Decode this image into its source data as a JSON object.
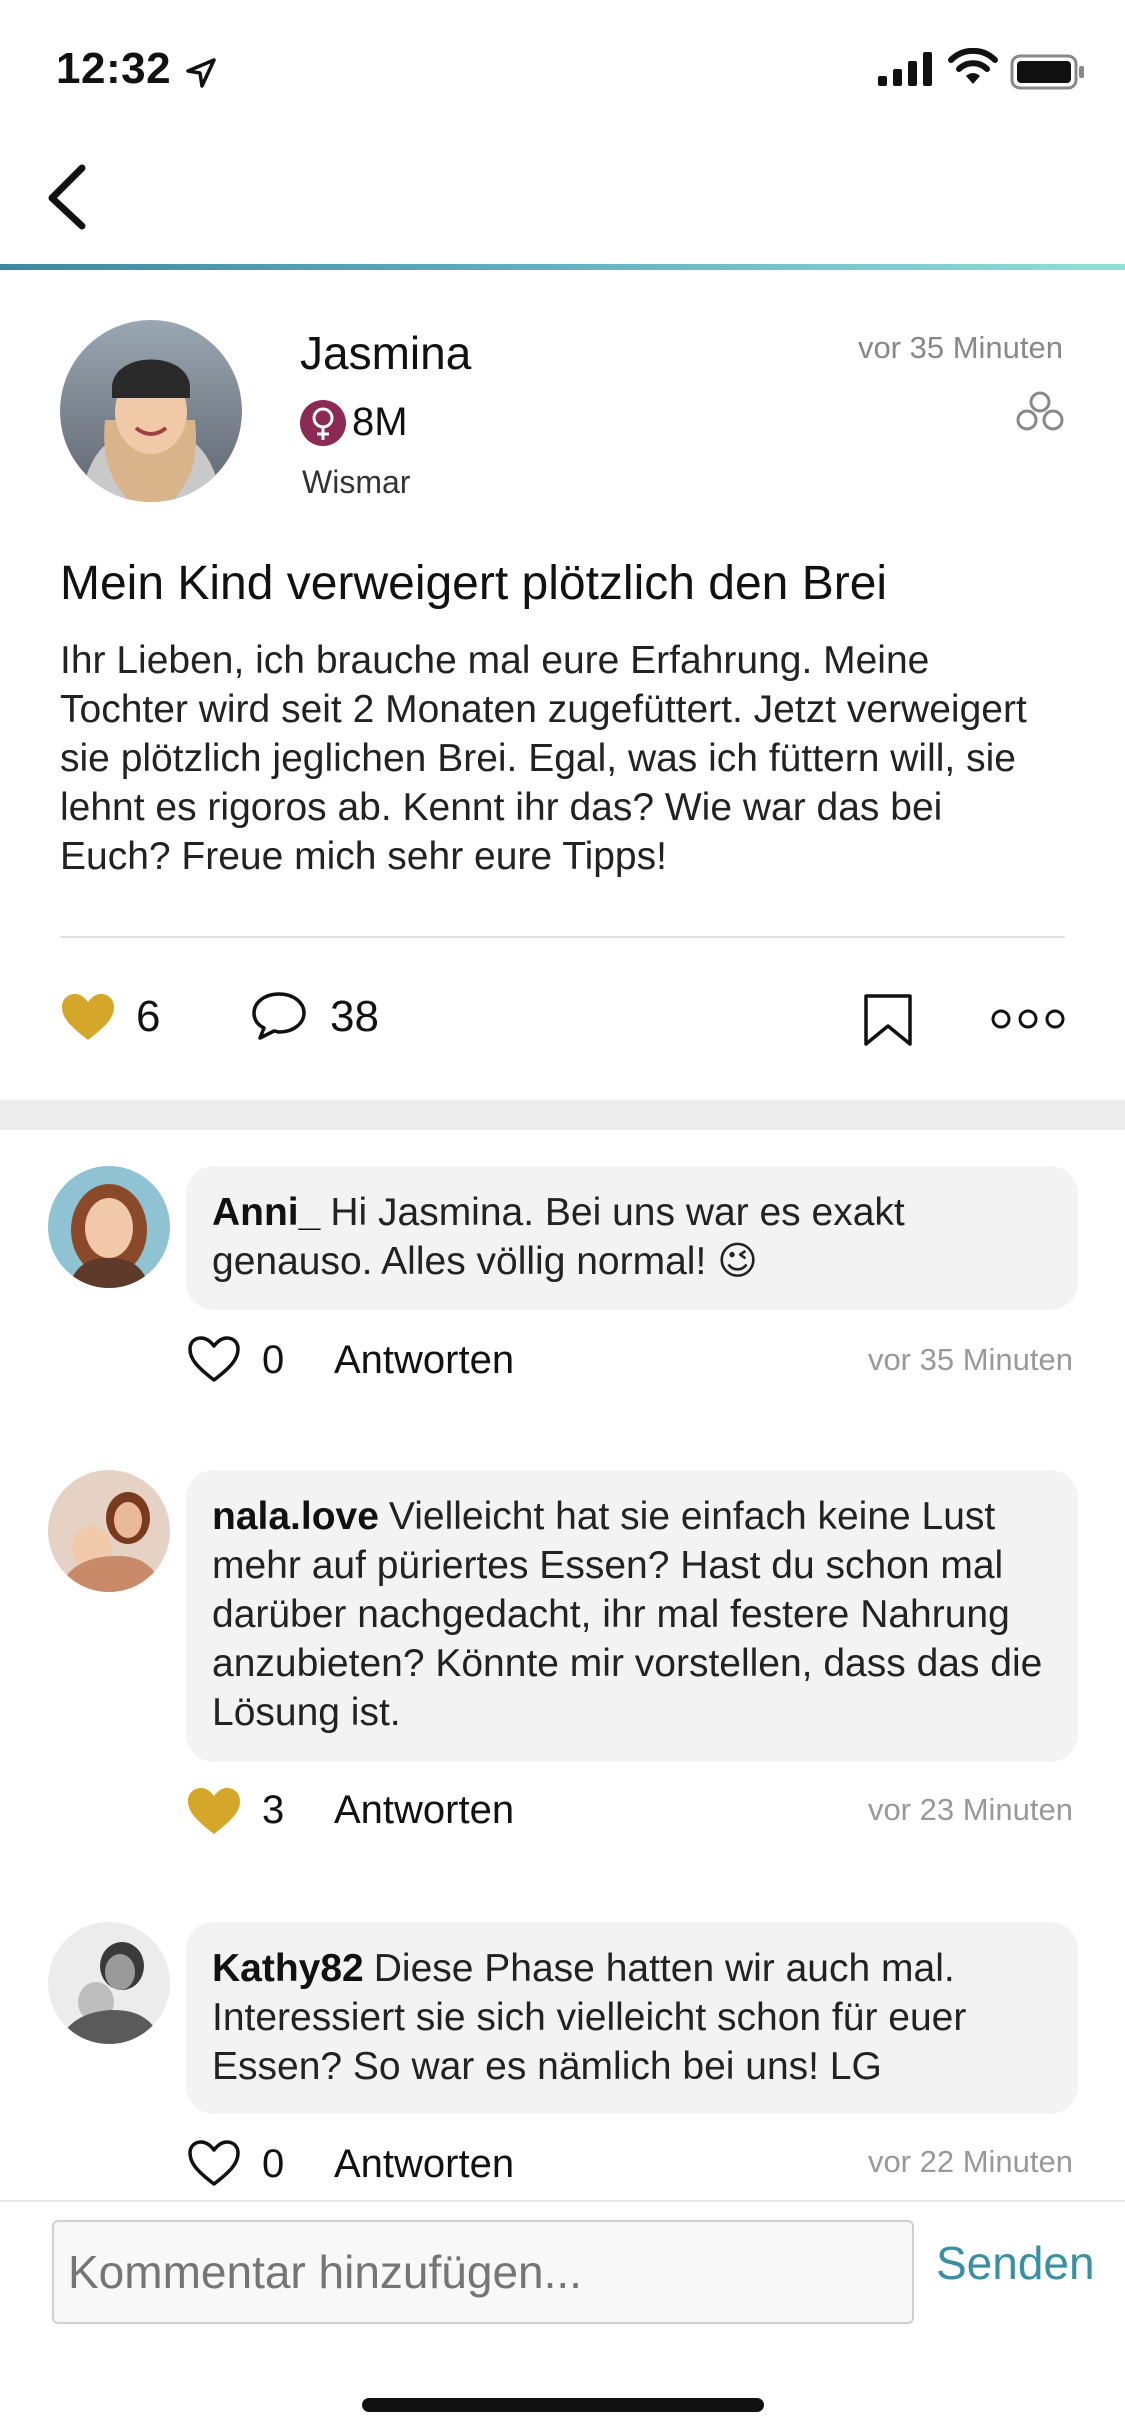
{
  "status_bar": {
    "time": "12:32"
  },
  "post": {
    "author": "Jasmina",
    "baby_age": "8M",
    "location": "Wismar",
    "time": "vor 35 Minuten",
    "title": "Mein Kind verweigert plötzlich den Brei",
    "body": "Ihr Lieben, ich brauche mal eure Erfahrung. Meine Tochter wird seit 2 Monaten zugefüttert. Jetzt verweigert sie plötzlich jeglichen Brei. Egal, was ich füttern will, sie lehnt es rigoros ab. Kennt ihr das? Wie war das bei Euch? Freue mich sehr eure Tipps!",
    "likes": "6",
    "comments": "38"
  },
  "comments": [
    {
      "user": "Anni_",
      "text": "Hi Jasmina. Bei uns war es exakt genauso. Alles völlig normal! 😉",
      "likes": "0",
      "reply_label": "Antworten",
      "time": "vor 35 Minuten",
      "liked": false
    },
    {
      "user": "nala.love",
      "text": "Vielleicht hat sie einfach keine Lust mehr auf püriertes Essen? Hast du schon mal darüber nachgedacht, ihr mal festere Nahrung anzubieten? Könnte mir vorstellen, dass das die Lösung ist.",
      "likes": "3",
      "reply_label": "Antworten",
      "time": "vor 23 Minuten",
      "liked": true
    },
    {
      "user": "Kathy82",
      "text": "Diese Phase hatten wir auch mal. Interessiert sie sich vielleicht schon für euer Essen? So war es nämlich bei uns! LG",
      "likes": "0",
      "reply_label": "Antworten",
      "time": "vor 22 Minuten",
      "liked": false
    }
  ],
  "composer": {
    "placeholder": "Kommentar hinzufügen...",
    "send_label": "Senden"
  },
  "colors": {
    "accent": "#3a8fa0",
    "heart_liked": "#d4a62a",
    "badge_female": "#8a2a55",
    "bubble_bg": "#f3f3f3"
  }
}
